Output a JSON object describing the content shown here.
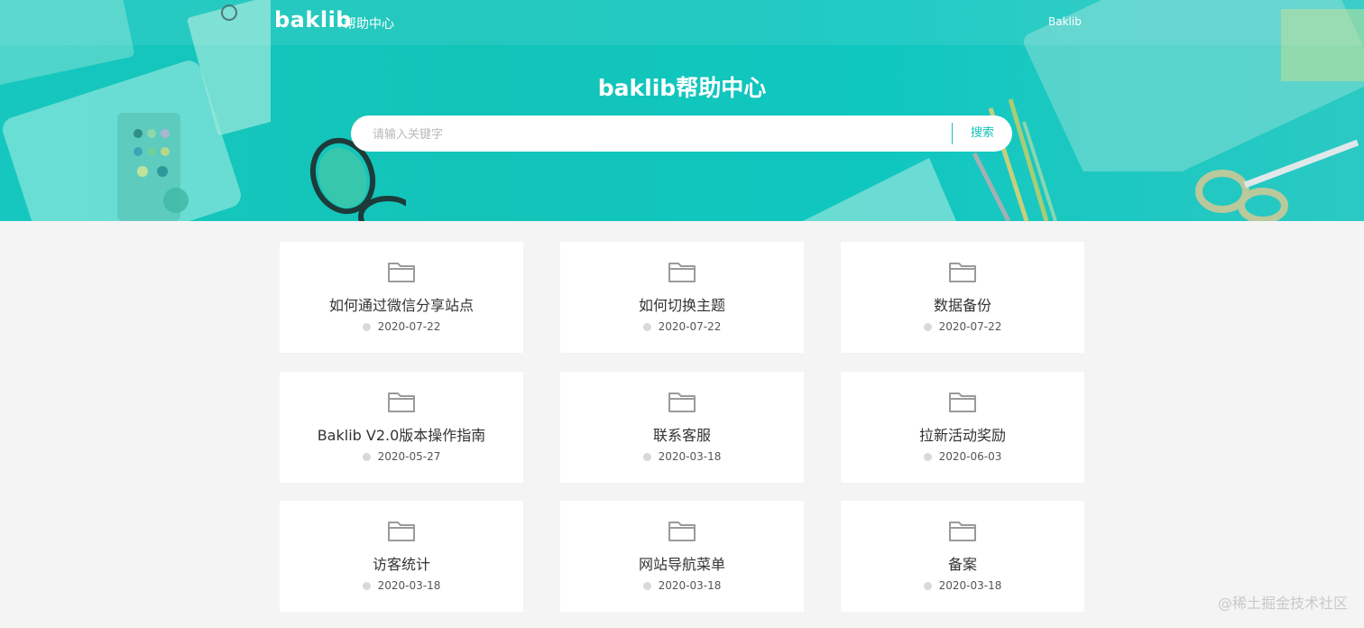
{
  "header": {
    "logo_word": "baklib",
    "logo_sub": "帮助中心",
    "nav_link": "Baklib"
  },
  "hero": {
    "title": "baklib帮助中心",
    "search": {
      "placeholder": "请输入关键字",
      "value": "",
      "button_label": "搜索"
    }
  },
  "colors": {
    "accent": "#16c3b8",
    "card_bg": "#ffffff",
    "page_bg": "#f4f4f4"
  },
  "cards": [
    {
      "title": "如何通过微信分享站点",
      "date": "2020-07-22",
      "icon": "folder-icon"
    },
    {
      "title": "如何切换主题",
      "date": "2020-07-22",
      "icon": "folder-icon"
    },
    {
      "title": "数据备份",
      "date": "2020-07-22",
      "icon": "folder-icon"
    },
    {
      "title": "Baklib V2.0版本操作指南",
      "date": "2020-05-27",
      "icon": "folder-icon"
    },
    {
      "title": "联系客服",
      "date": "2020-03-18",
      "icon": "folder-icon"
    },
    {
      "title": "拉新活动奖励",
      "date": "2020-06-03",
      "icon": "folder-icon"
    },
    {
      "title": "访客统计",
      "date": "2020-03-18",
      "icon": "folder-icon"
    },
    {
      "title": "网站导航菜单",
      "date": "2020-03-18",
      "icon": "folder-icon"
    },
    {
      "title": "备案",
      "date": "2020-03-18",
      "icon": "folder-icon"
    }
  ],
  "watermark": "@稀土掘金技术社区"
}
